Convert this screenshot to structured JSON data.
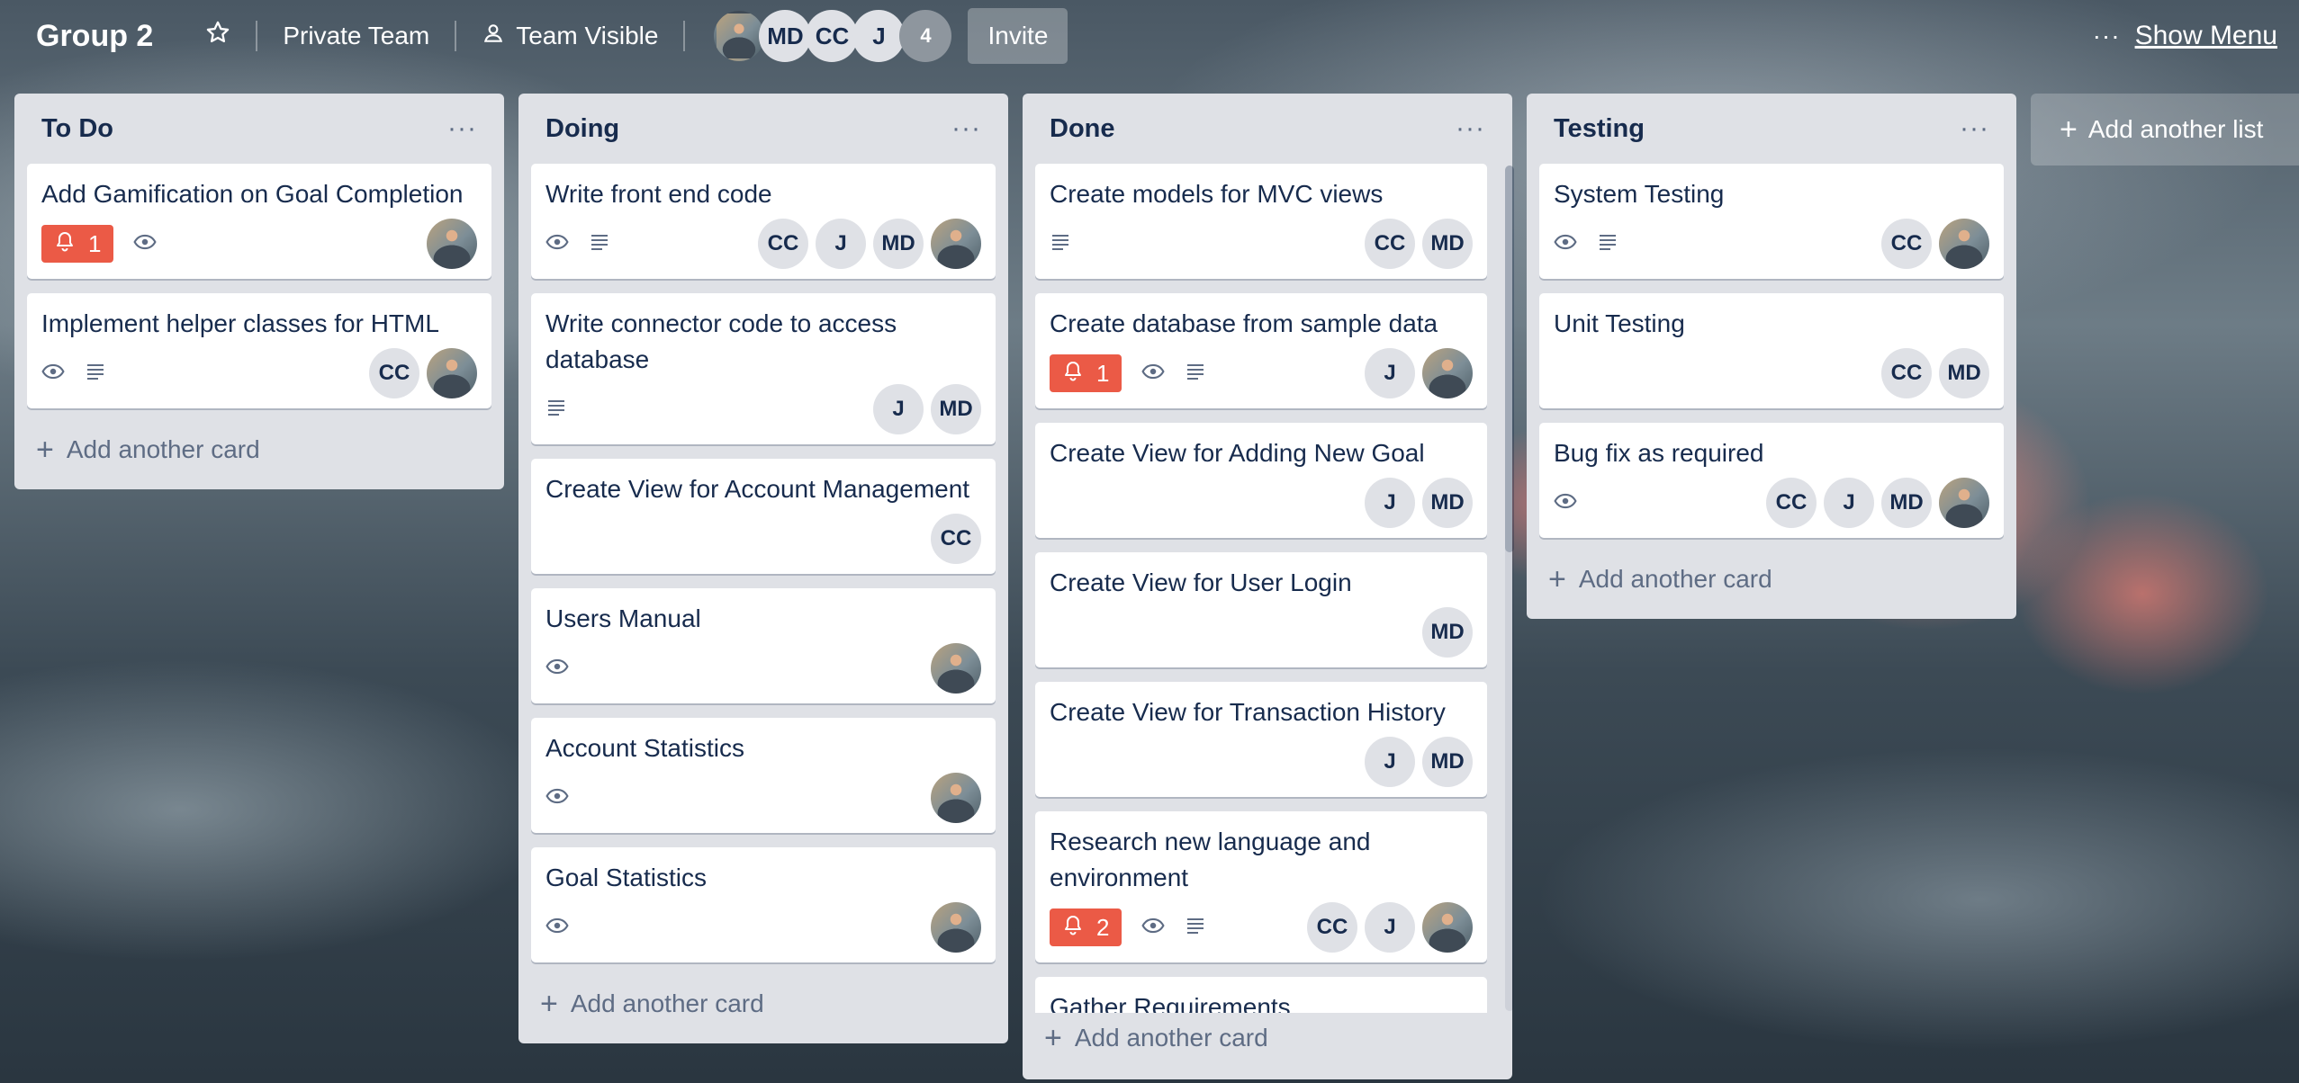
{
  "header": {
    "board_title": "Group 2",
    "team_label": "Private Team",
    "visibility_label": "Team Visible",
    "members": [
      "MD",
      "CC",
      "J"
    ],
    "member_overflow": "4",
    "invite_label": "Invite",
    "menu_dots": "···",
    "show_menu_label": "Show Menu"
  },
  "lists": [
    {
      "title": "To Do",
      "add_label": "Add another card",
      "cards": [
        {
          "title": "Add Gamification on Goal Completion",
          "due": "1",
          "eye": true,
          "desc": false,
          "members": [
            "photo"
          ]
        },
        {
          "title": "Implement helper classes for HTML",
          "due": "",
          "eye": true,
          "desc": true,
          "members": [
            "CC",
            "photo"
          ]
        }
      ]
    },
    {
      "title": "Doing",
      "add_label": "Add another card",
      "cards": [
        {
          "title": "Write front end code",
          "due": "",
          "eye": true,
          "desc": true,
          "members": [
            "CC",
            "J",
            "MD",
            "photo"
          ]
        },
        {
          "title": "Write connector code to access database",
          "due": "",
          "eye": false,
          "desc": true,
          "members": [
            "J",
            "MD"
          ]
        },
        {
          "title": "Create View for Account Management",
          "due": "",
          "eye": false,
          "desc": false,
          "members": [
            "CC"
          ]
        },
        {
          "title": "Users Manual",
          "due": "",
          "eye": true,
          "desc": false,
          "members": [
            "photo"
          ]
        },
        {
          "title": "Account Statistics",
          "due": "",
          "eye": true,
          "desc": false,
          "members": [
            "photo"
          ]
        },
        {
          "title": "Goal Statistics",
          "due": "",
          "eye": true,
          "desc": false,
          "members": [
            "photo"
          ]
        }
      ]
    },
    {
      "title": "Done",
      "add_label": "Add another card",
      "cards": [
        {
          "title": "Create models for MVC views",
          "due": "",
          "eye": false,
          "desc": true,
          "members": [
            "CC",
            "MD"
          ]
        },
        {
          "title": "Create database from sample data",
          "due": "1",
          "eye": true,
          "desc": true,
          "members": [
            "J",
            "photo"
          ]
        },
        {
          "title": "Create View for Adding New Goal",
          "due": "",
          "eye": false,
          "desc": false,
          "members": [
            "J",
            "MD"
          ]
        },
        {
          "title": "Create View for User Login",
          "due": "",
          "eye": false,
          "desc": false,
          "members": [
            "MD"
          ]
        },
        {
          "title": "Create View for Transaction History",
          "due": "",
          "eye": false,
          "desc": false,
          "members": [
            "J",
            "MD"
          ]
        },
        {
          "title": "Research new language and environment",
          "due": "2",
          "eye": true,
          "desc": true,
          "members": [
            "CC",
            "J",
            "photo"
          ]
        },
        {
          "title": "Gather Requirements",
          "due": "",
          "eye": false,
          "desc": false,
          "members": []
        }
      ]
    },
    {
      "title": "Testing",
      "add_label": "Add another card",
      "cards": [
        {
          "title": "System Testing",
          "due": "",
          "eye": true,
          "desc": true,
          "members": [
            "CC",
            "photo"
          ]
        },
        {
          "title": "Unit Testing",
          "due": "",
          "eye": false,
          "desc": false,
          "members": [
            "CC",
            "MD"
          ]
        },
        {
          "title": "Bug fix as required",
          "due": "",
          "eye": true,
          "desc": false,
          "members": [
            "CC",
            "J",
            "MD",
            "photo"
          ]
        }
      ]
    }
  ],
  "add_list_label": "Add another list",
  "colors": {
    "due_badge": "#eb5a46",
    "list_bg": "#dfe1e6",
    "text": "#172b4d",
    "muted": "#5e6c84"
  }
}
